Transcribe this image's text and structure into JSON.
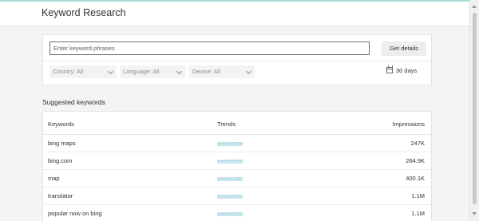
{
  "header": {
    "title": "Keyword Research"
  },
  "search": {
    "placeholder": "Enter keyword phrases",
    "button_label": "Get details",
    "filters": [
      {
        "label": "Country: All"
      },
      {
        "label": "Language: All"
      },
      {
        "label": "Device: All"
      }
    ],
    "date_range": "30 days"
  },
  "suggested": {
    "label": "Suggested keywords",
    "columns": {
      "keywords": "Keywords",
      "trends": "Trends",
      "impressions": "Impressions"
    },
    "rows": [
      {
        "keyword": "bing maps",
        "impressions": "247K"
      },
      {
        "keyword": "bing.com",
        "impressions": "264.9K"
      },
      {
        "keyword": "map",
        "impressions": "400.1K"
      },
      {
        "keyword": "translator",
        "impressions": "1.1M"
      },
      {
        "keyword": "popular now on bing",
        "impressions": "1.1M"
      }
    ]
  },
  "colors": {
    "accent_top": "#a8dcd5",
    "trend_fill": "#c6e6ec",
    "trend_line": "#7dbcd0"
  }
}
